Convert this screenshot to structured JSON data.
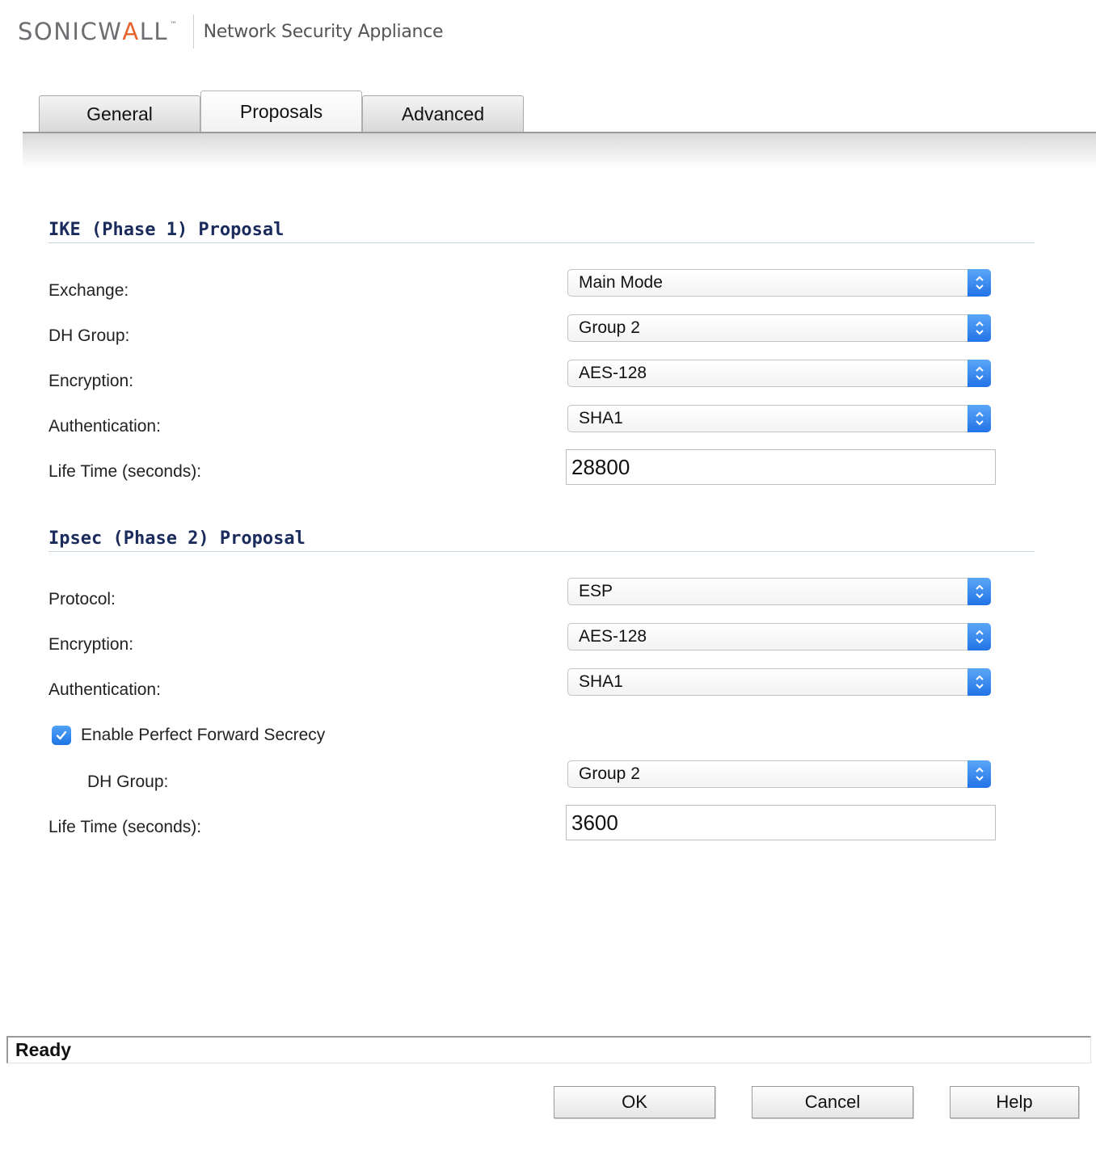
{
  "header": {
    "logo_part1": "SONICW",
    "logo_part2": "A",
    "logo_part3": "LL",
    "logo_tm": "™",
    "product_name": "Network Security Appliance"
  },
  "tabs": [
    {
      "label": "General",
      "active": false
    },
    {
      "label": "Proposals",
      "active": true
    },
    {
      "label": "Advanced",
      "active": false
    }
  ],
  "ike": {
    "title": "IKE (Phase 1) Proposal",
    "exchange": {
      "label": "Exchange:",
      "value": "Main Mode"
    },
    "dh_group": {
      "label": "DH Group:",
      "value": "Group 2"
    },
    "encryption": {
      "label": "Encryption:",
      "value": "AES-128"
    },
    "authentication": {
      "label": "Authentication:",
      "value": "SHA1"
    },
    "lifetime": {
      "label": "Life Time (seconds):",
      "value": "28800"
    }
  },
  "ipsec": {
    "title": "Ipsec (Phase 2) Proposal",
    "protocol": {
      "label": "Protocol:",
      "value": "ESP"
    },
    "encryption": {
      "label": "Encryption:",
      "value": "AES-128"
    },
    "authentication": {
      "label": "Authentication:",
      "value": "SHA1"
    },
    "pfs": {
      "label": "Enable Perfect Forward Secrecy",
      "checked": true
    },
    "dh_group": {
      "label": "DH Group:",
      "value": "Group 2"
    },
    "lifetime": {
      "label": "Life Time (seconds):",
      "value": "3600"
    }
  },
  "status": {
    "text": "Ready"
  },
  "buttons": {
    "ok": "OK",
    "cancel": "Cancel",
    "help": "Help"
  },
  "colors": {
    "accent": "#2273e6",
    "heading": "#1a2b5c",
    "brand_orange": "#e8622b"
  },
  "icons": {
    "select_stepper": "chevron-up-down-icon",
    "checkbox": "checkmark-icon"
  }
}
